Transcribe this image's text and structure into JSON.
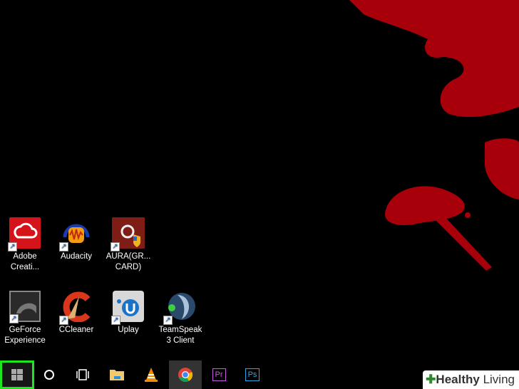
{
  "desktop": {
    "icons": [
      {
        "label": "Adobe Creati...",
        "name": "adobe-creative-cloud",
        "color": "#d4141a"
      },
      {
        "label": "Audacity",
        "name": "audacity",
        "color": "#f39c12"
      },
      {
        "label": "AURA(GR... CARD)",
        "name": "aura",
        "color": "#8b1a1a"
      },
      {
        "label": "GeForce Experience",
        "name": "geforce-experience",
        "color": "#333333"
      },
      {
        "label": "CCleaner",
        "name": "ccleaner",
        "color": "#d9361c"
      },
      {
        "label": "Uplay",
        "name": "uplay",
        "color": "#d8d8d8"
      },
      {
        "label": "TeamSpeak 3 Client",
        "name": "teamspeak",
        "color": "#2b4a6b"
      }
    ]
  },
  "taskbar": {
    "items": [
      {
        "name": "start",
        "icon": "windows-icon"
      },
      {
        "name": "cortana",
        "icon": "circle-icon"
      },
      {
        "name": "task-view",
        "icon": "task-view-icon"
      },
      {
        "name": "file-explorer",
        "icon": "folder-icon"
      },
      {
        "name": "vlc",
        "icon": "vlc-cone-icon"
      },
      {
        "name": "chrome",
        "icon": "chrome-icon"
      },
      {
        "name": "premiere",
        "icon": "Pr"
      },
      {
        "name": "photoshop",
        "icon": "Ps"
      }
    ]
  },
  "colors": {
    "highlight": "#1ee61e",
    "splatter": "#a8000b"
  },
  "watermark": {
    "brand1": "Healthy",
    "brand2": "Living"
  }
}
